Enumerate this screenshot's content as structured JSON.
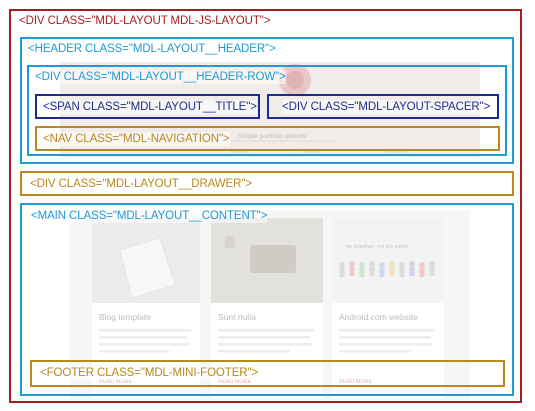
{
  "colors": {
    "red": "#a61e22",
    "blue": "#1f9ad3",
    "navy": "#1d2c8f",
    "gold": "#b8891e"
  },
  "background_page": {
    "search_text": "Simple portfolio website",
    "cards": [
      {
        "title": "Blog template",
        "link": "READ MORE"
      },
      {
        "title": "Sunt nulla",
        "link": "READ MORE"
      },
      {
        "title": "Android.com website",
        "link": "READ MORE",
        "image_caption": "be together. not the same."
      }
    ]
  },
  "diagram": {
    "layout": "<DIV CLASS=\"MDL-LAYOUT MDL-JS-LAYOUT\">",
    "header": "<HEADER CLASS=\"MDL-LAYOUT__HEADER\">",
    "header_row": "<DIV CLASS=\"MDL-LAYOUT__HEADER-ROW\">",
    "title": "<SPAN CLASS=\"MDL-LAYOUT__TITLE\">",
    "spacer": "<DIV CLASS=\"MDL-LAYOUT-SPACER\">",
    "navigation": "<NAV CLASS=\"MDL-NAVIGATION\">",
    "drawer": "<DIV CLASS=\"MDL-LAYOUT__DRAWER\">",
    "content": "<MAIN CLASS=\"MDL-LAYOUT__CONTENT\">",
    "footer": "<FOOTER CLASS=\"MDL-MINI-FOOTER\">"
  }
}
